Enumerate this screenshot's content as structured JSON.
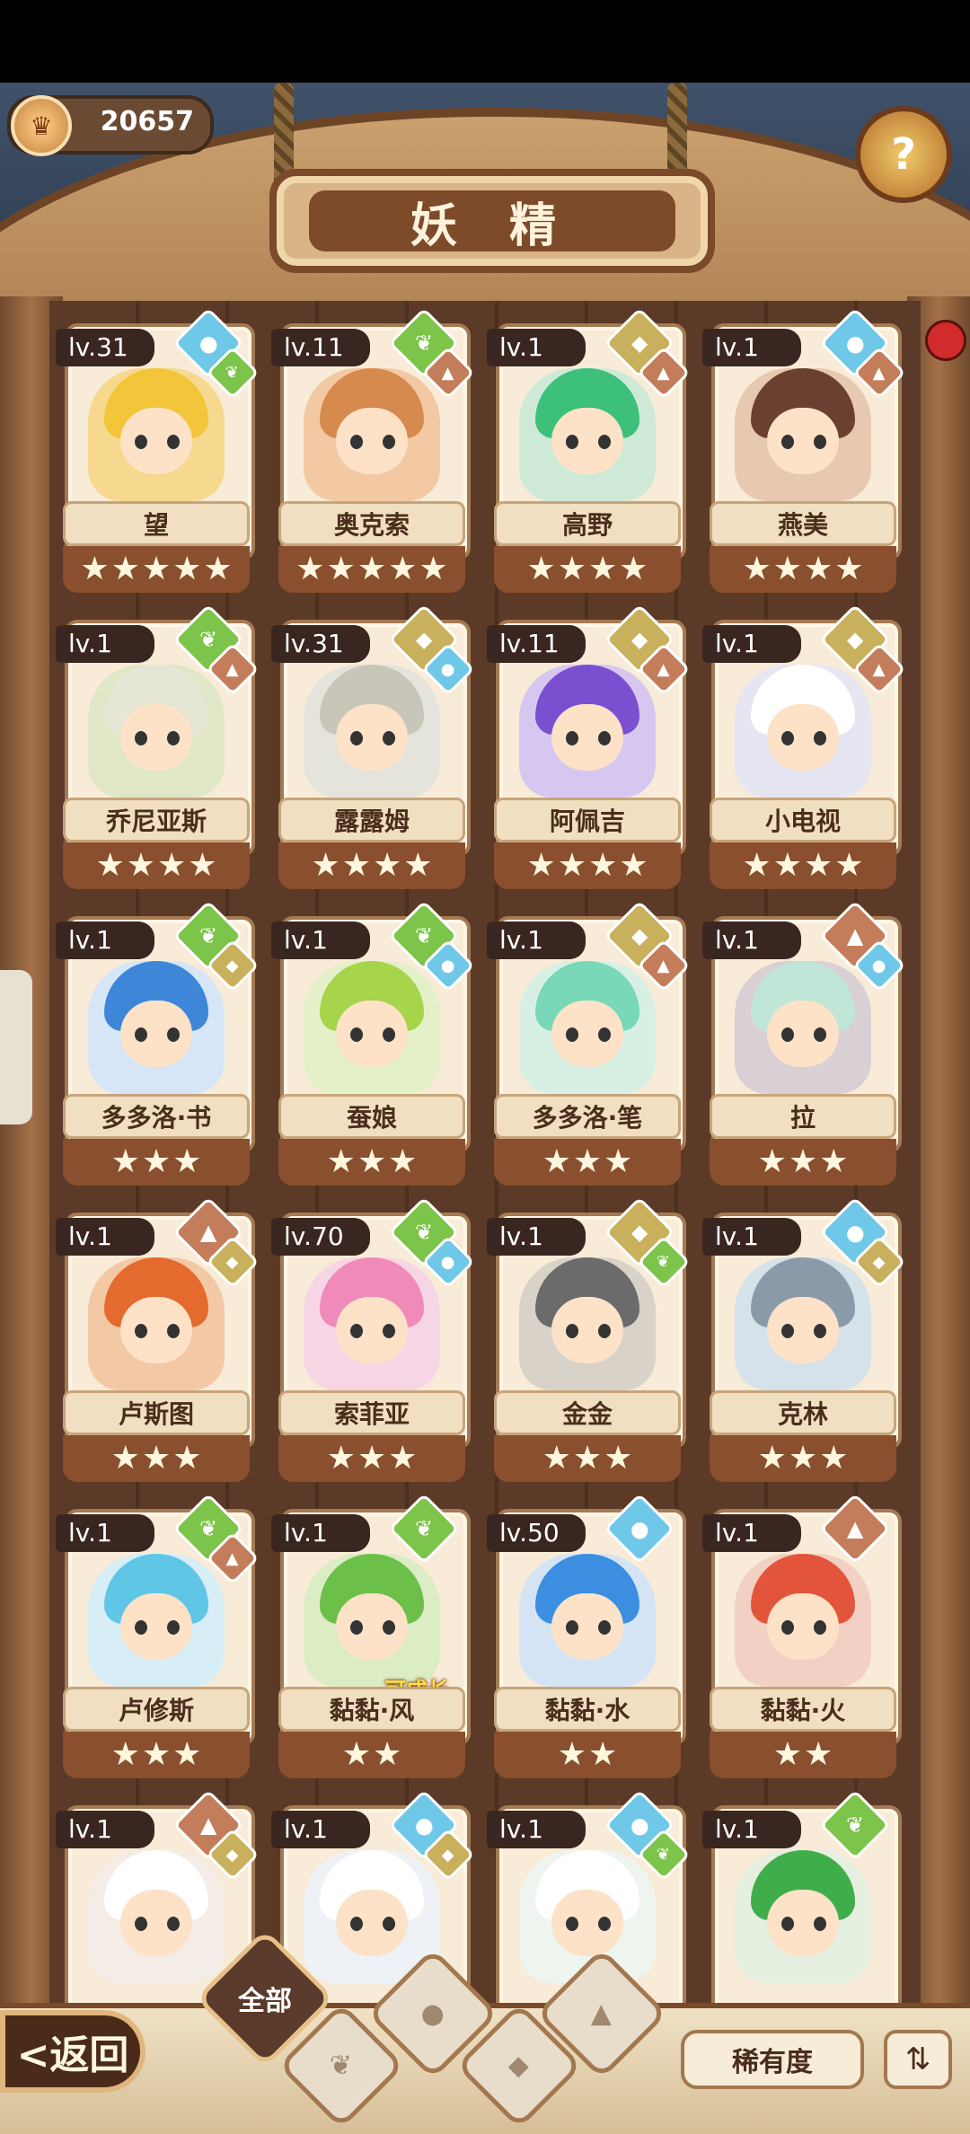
{
  "header": {
    "title": "妖 精",
    "currency_value": "20657",
    "help_label": "?"
  },
  "colors": {
    "leaf": "#7cc44a",
    "water": "#6fc8e8",
    "earth": "#c9b05c",
    "mountain": "#c47d5b"
  },
  "cards": [
    {
      "level": "lv.31",
      "name": "望",
      "stars": 5,
      "main": "water",
      "sub": "leaf",
      "hair": "#f2c53a",
      "bg": "#f6d98f"
    },
    {
      "level": "lv.11",
      "name": "奥克索",
      "stars": 5,
      "main": "leaf",
      "sub": "mountain",
      "hair": "#d68a4e",
      "bg": "#f3c9a4"
    },
    {
      "level": "lv.1",
      "name": "高野",
      "stars": 4,
      "main": "earth",
      "sub": "mountain",
      "hair": "#3cc07a",
      "bg": "#cfe9d7"
    },
    {
      "level": "lv.1",
      "name": "燕美",
      "stars": 4,
      "main": "water",
      "sub": "mountain",
      "hair": "#6b4030",
      "bg": "#e7c9b2"
    },
    {
      "level": "lv.1",
      "name": "乔尼亚斯",
      "stars": 4,
      "main": "leaf",
      "sub": "mountain",
      "hair": "#e6e6d6",
      "bg": "#dfe7c6"
    },
    {
      "level": "lv.31",
      "name": "露露姆",
      "stars": 4,
      "main": "earth",
      "sub": "water",
      "hair": "#c8c6b8",
      "bg": "#e4e4dc"
    },
    {
      "level": "lv.11",
      "name": "阿佩吉",
      "stars": 4,
      "main": "earth",
      "sub": "mountain",
      "hair": "#7a4fd0",
      "bg": "#d6c7f0"
    },
    {
      "level": "lv.1",
      "name": "小电视",
      "stars": 4,
      "main": "earth",
      "sub": "mountain",
      "hair": "#ffffff",
      "bg": "#e6e6f2"
    },
    {
      "level": "lv.1",
      "name": "多多洛·书",
      "stars": 3,
      "main": "leaf",
      "sub": "earth",
      "hair": "#3d86d8",
      "bg": "#d6e6f6"
    },
    {
      "level": "lv.1",
      "name": "蚕娘",
      "stars": 3,
      "main": "leaf",
      "sub": "water",
      "hair": "#a6d44a",
      "bg": "#e4f0c8"
    },
    {
      "level": "lv.1",
      "name": "多多洛·笔",
      "stars": 3,
      "main": "earth",
      "sub": "mountain",
      "hair": "#78d8b8",
      "bg": "#d8f0e4"
    },
    {
      "level": "lv.1",
      "name": "拉",
      "stars": 3,
      "main": "mountain",
      "sub": "water",
      "hair": "#bfe6d6",
      "bg": "#d8d0d4"
    },
    {
      "level": "lv.1",
      "name": "卢斯图",
      "stars": 3,
      "main": "mountain",
      "sub": "earth",
      "hair": "#e46a2e",
      "bg": "#f2c9a4"
    },
    {
      "level": "lv.70",
      "name": "索菲亚",
      "stars": 3,
      "main": "leaf",
      "sub": "water",
      "hair": "#f08ab8",
      "bg": "#f6d6e4"
    },
    {
      "level": "lv.1",
      "name": "金金",
      "stars": 3,
      "main": "earth",
      "sub": "leaf",
      "hair": "#6b6b6b",
      "bg": "#d8d2c8"
    },
    {
      "level": "lv.1",
      "name": "克林",
      "stars": 3,
      "main": "water",
      "sub": "earth",
      "hair": "#8a9aa8",
      "bg": "#d6e2ea"
    },
    {
      "level": "lv.1",
      "name": "卢修斯",
      "stars": 3,
      "main": "leaf",
      "sub": "mountain",
      "hair": "#5fc6e6",
      "bg": "#d8eef6"
    },
    {
      "level": "lv.1",
      "name": "黏黏·风",
      "stars": 2,
      "main": "leaf",
      "sub": "",
      "hair": "#6cc04a",
      "bg": "#dcecc4",
      "badge": "可成长"
    },
    {
      "level": "lv.50",
      "name": "黏黏·水",
      "stars": 2,
      "main": "water",
      "sub": "",
      "hair": "#3b8ee0",
      "bg": "#d4e4f4"
    },
    {
      "level": "lv.1",
      "name": "黏黏·火",
      "stars": 2,
      "main": "mountain",
      "sub": "",
      "hair": "#e2553a",
      "bg": "#f2d0c4"
    },
    {
      "level": "lv.1",
      "name": "",
      "stars": 0,
      "main": "mountain",
      "sub": "earth",
      "hair": "#ffffff",
      "bg": "#f4ece6"
    },
    {
      "level": "lv.1",
      "name": "",
      "stars": 0,
      "main": "water",
      "sub": "earth",
      "hair": "#ffffff",
      "bg": "#eef2f6"
    },
    {
      "level": "lv.1",
      "name": "",
      "stars": 0,
      "main": "water",
      "sub": "leaf",
      "hair": "#ffffff",
      "bg": "#eef4ee"
    },
    {
      "level": "lv.1",
      "name": "",
      "stars": 0,
      "main": "leaf",
      "sub": "",
      "hair": "#3fae4a",
      "bg": "#e6f0e0"
    }
  ],
  "bottom": {
    "back_label": "<返回",
    "filter_all_label": "全部",
    "sort_label": "稀有度",
    "order_icon": "⇅"
  },
  "icons": {
    "leaf": "leaf-icon",
    "water": "water-drop-icon",
    "earth": "earth-icon",
    "mountain": "mountain-icon"
  }
}
